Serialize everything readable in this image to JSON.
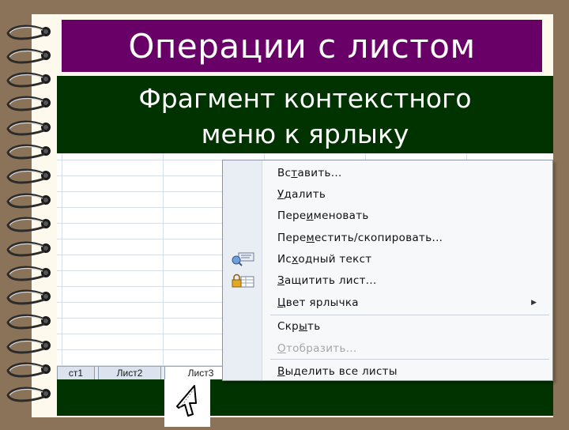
{
  "slide": {
    "title": "Операции с листом",
    "subtitle_line1": "Фрагмент контекстного",
    "subtitle_line2": "меню к ярлыку"
  },
  "sheet_tabs": [
    {
      "label": "ст1"
    },
    {
      "label": "Лист2"
    },
    {
      "label": "Лист3",
      "active": true
    }
  ],
  "context_menu": {
    "items": [
      {
        "pre": "Вс",
        "u": "т",
        "post": "авить...",
        "icon": "",
        "disabled": false
      },
      {
        "pre": "",
        "u": "У",
        "post": "далить",
        "icon": "",
        "disabled": false
      },
      {
        "pre": "Пере",
        "u": "и",
        "post": "меновать",
        "icon": "",
        "disabled": false
      },
      {
        "pre": "Пере",
        "u": "м",
        "post": "естить/скопировать...",
        "icon": "",
        "disabled": false
      },
      {
        "pre": "Ис",
        "u": "х",
        "post": "одный текст",
        "icon": "view-code-icon",
        "disabled": false
      },
      {
        "pre": "",
        "u": "З",
        "post": "ащитить лист...",
        "icon": "protect-sheet-icon",
        "disabled": false
      },
      {
        "pre": "",
        "u": "Ц",
        "post": "вет ярлычка",
        "icon": "",
        "disabled": false,
        "submenu": true
      },
      {
        "pre": "Скр",
        "u": "ы",
        "post": "ть",
        "icon": "",
        "disabled": false
      },
      {
        "pre": "",
        "u": "О",
        "post": "тобразить...",
        "icon": "",
        "disabled": true
      },
      {
        "pre": "",
        "u": "В",
        "post": "ыделить все листы",
        "icon": "",
        "disabled": false
      }
    ]
  },
  "icons": [
    "spiral-ring-icon",
    "view-code-icon",
    "protect-sheet-icon",
    "submenu-arrow-icon",
    "mouse-pointer-icon"
  ],
  "colors": {
    "background": "#8B7359",
    "paper": "#FDF9EC",
    "title_bar": "#680068",
    "subtitle_box": "#003300",
    "menu_bg": "#F7F8FA",
    "disabled_text": "#A6A6A6"
  }
}
